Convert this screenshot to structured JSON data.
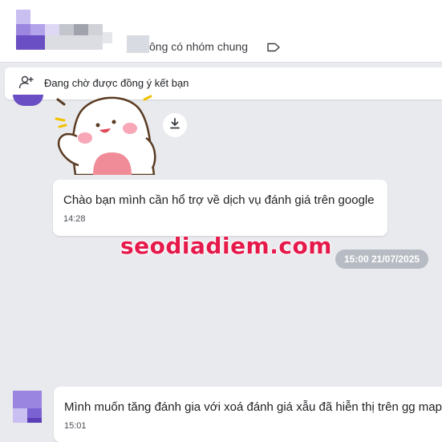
{
  "header": {
    "subtitle": "ông có nhóm chung",
    "tag_icon": "tag-icon"
  },
  "friend_request": {
    "text": "Đang chờ được đồng ý kết bạn",
    "icon": "add-user-icon"
  },
  "sticker": {
    "name": "sticker",
    "download_icon": "download-icon"
  },
  "messages": [
    {
      "text": "Chào bạn mình cần hổ trợ về dịch vụ đánh giá trên google",
      "time": "14:28"
    },
    {
      "text": "Mình muốn tăng đánh gia với xoá đánh giá xẫu đã hiễn thị trên gg map",
      "time": "15:01"
    }
  ],
  "date_separator": "15:00 21/07/2025",
  "watermark": "seodiadiem.com",
  "colors": {
    "background": "#e9eaee",
    "bubble": "#ffffff",
    "date_pill": "#b7bbc3",
    "watermark": "#e6194b",
    "avatar_purple": "#6a4ec4"
  }
}
